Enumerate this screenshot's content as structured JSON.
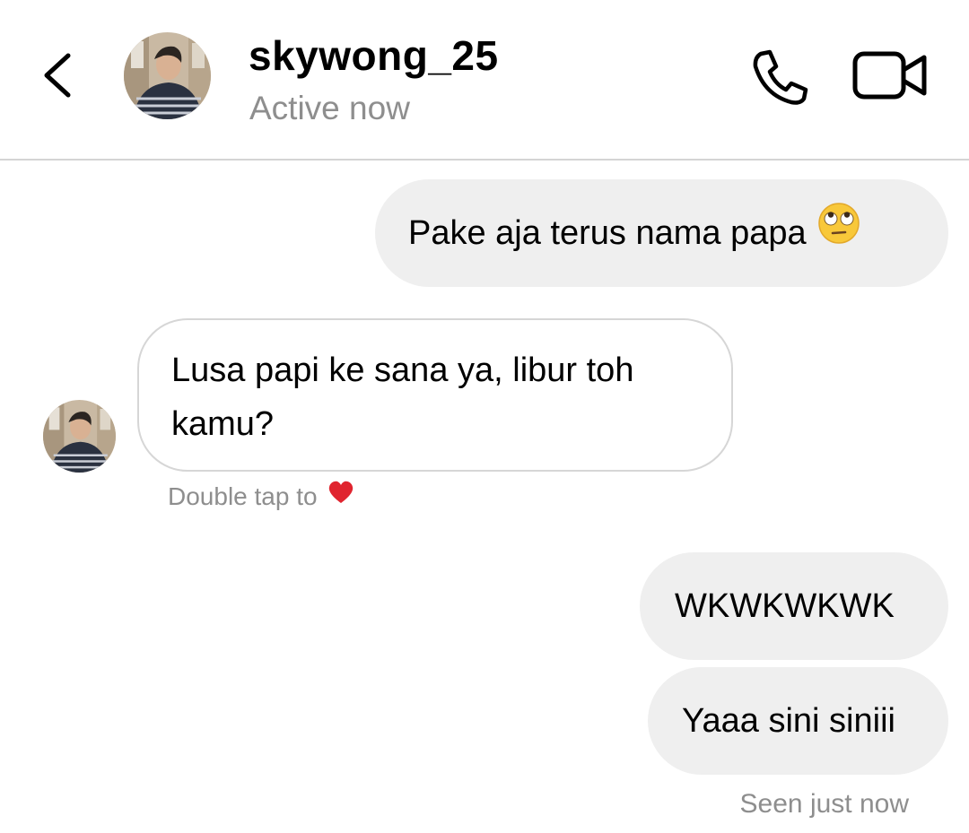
{
  "header": {
    "username": "skywong_25",
    "status": "Active now",
    "back_icon": "chevron-left-icon",
    "call_icon": "phone-icon",
    "video_icon": "video-camera-icon"
  },
  "messages": [
    {
      "direction": "outgoing",
      "text": "Pake aja terus nama papa",
      "emoji": "face-with-rolling-eyes-emoji"
    },
    {
      "direction": "incoming",
      "text": "Lusa papi ke sana ya, libur toh kamu?"
    },
    {
      "direction": "outgoing",
      "text": "WKWKWKWK"
    },
    {
      "direction": "outgoing",
      "text": "Yaaa sini siniii"
    }
  ],
  "hints": {
    "double_tap": "Double tap to",
    "double_tap_icon": "red-heart-icon",
    "seen": "Seen just now"
  },
  "colors": {
    "outgoing_bubble": "#efefef",
    "incoming_border": "#d6d6d6",
    "secondary_text": "#8e8e8e",
    "heart": "#e0242f"
  }
}
